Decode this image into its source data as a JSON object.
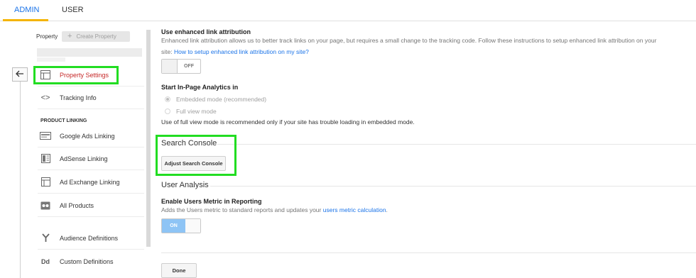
{
  "tabs": [
    {
      "label": "ADMIN",
      "active": true
    },
    {
      "label": "USER",
      "active": false
    }
  ],
  "sidebar": {
    "property_label": "Property",
    "create_property_label": "Create Property",
    "section_product_linking": "PRODUCT LINKING",
    "items": [
      {
        "label": "Property Settings",
        "icon": "layout-icon",
        "active": true
      },
      {
        "label": "Tracking Info",
        "icon": "code-brackets-icon",
        "active": false
      },
      {
        "label": "Google Ads Linking",
        "icon": "ads-icon",
        "active": false
      },
      {
        "label": "AdSense Linking",
        "icon": "adsense-icon",
        "active": false
      },
      {
        "label": "Ad Exchange Linking",
        "icon": "ad-exchange-icon",
        "active": false
      },
      {
        "label": "All Products",
        "icon": "products-icon",
        "active": false
      },
      {
        "label": "Audience Definitions",
        "icon": "audience-fork-icon",
        "active": false
      },
      {
        "label": "Custom Definitions",
        "icon": "dd-icon",
        "active": false
      }
    ]
  },
  "main": {
    "enhanced_link": {
      "title": "Use enhanced link attribution",
      "desc_line1": "Enhanced link attribution allows us to better track links on your page, but requires a small change to the tracking code. Follow these instructions to setup enhanced link attribution on your",
      "desc_prefix": "site: ",
      "desc_link": "How to setup enhanced link attribution on my site?",
      "toggle_label": "OFF"
    },
    "in_page": {
      "title": "Start In-Page Analytics in",
      "option1": "Embedded mode (recommended)",
      "option2": "Full view mode",
      "note": "Use of full view mode is recommended only if your site has trouble loading in embedded mode."
    },
    "search_console": {
      "title": "Search Console",
      "button": "Adjust Search Console"
    },
    "user_analysis": {
      "title": "User Analysis",
      "metric_title": "Enable Users Metric in Reporting",
      "desc_prefix": "Adds the Users metric to standard reports and updates your ",
      "desc_link": "users metric calculation",
      "desc_suffix": ".",
      "toggle_label": "ON"
    },
    "done_button": "Done"
  },
  "colors": {
    "accent": "#1a73e8",
    "active_nav": "#c62828",
    "highlight": "#22dd22",
    "tab_underline": "#f4b400"
  }
}
